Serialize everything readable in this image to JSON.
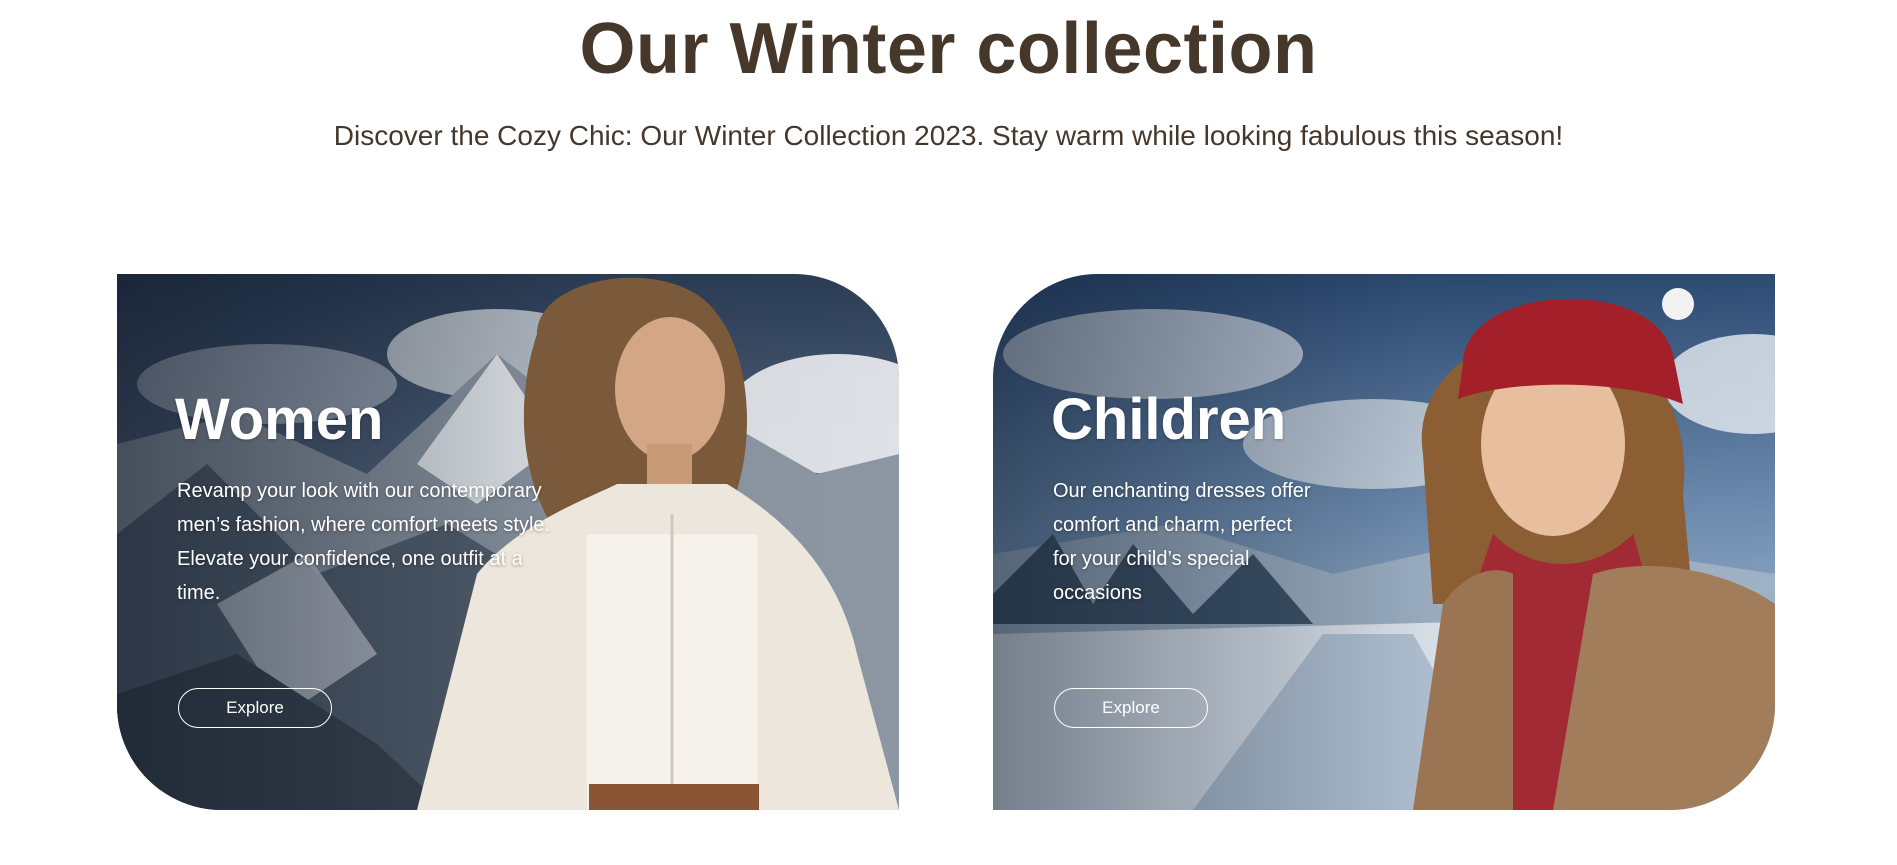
{
  "header": {
    "title": "Our Winter collection",
    "subtitle": "Discover the Cozy Chic: Our Winter Collection 2023. Stay warm while looking fabulous this season!"
  },
  "cards": [
    {
      "title": "Women",
      "description": "Revamp your look with our contemporary men’s fashion, where comfort meets style. Elevate your confidence, one outfit at a time.",
      "button_label": "Explore"
    },
    {
      "title": "Children",
      "description": "Our enchanting dresses offer comfort and charm, perfect for your child’s special occasions",
      "button_label": "Explore"
    }
  ],
  "colors": {
    "heading": "#45382b",
    "card_text": "#ffffff"
  }
}
